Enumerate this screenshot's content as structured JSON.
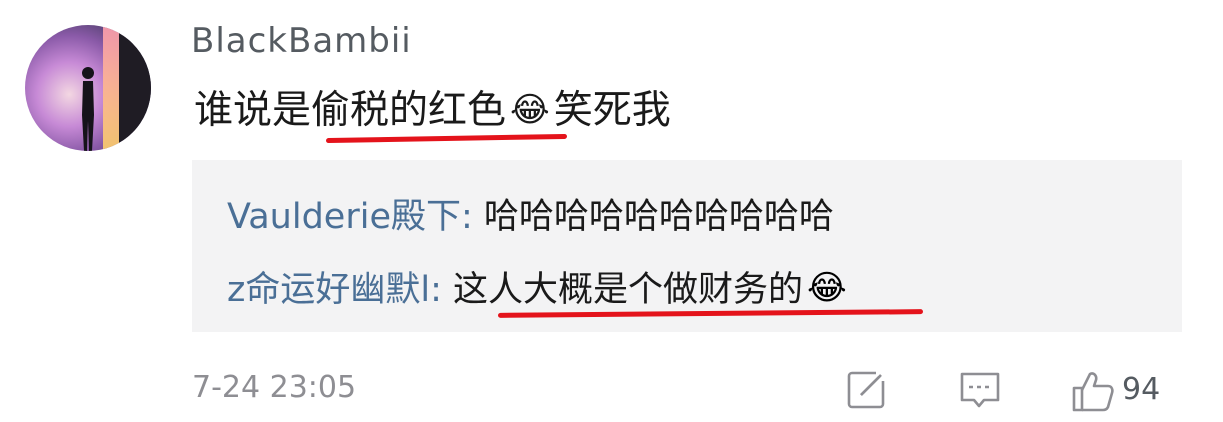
{
  "comment": {
    "username": "BlackBambii",
    "text_part1": "谁说是",
    "text_highlight": "偷税的红色",
    "emoji_1": "😂",
    "text_part2": "笑死我"
  },
  "replies": [
    {
      "user": "Vaulderie殿下",
      "separator": ": ",
      "message": "哈哈哈哈哈哈哈哈哈哈"
    },
    {
      "user": "z命运好幽默l",
      "separator": ": ",
      "message": "这人大概是个做财务的",
      "emoji": "😂"
    }
  ],
  "footer": {
    "timestamp": "7-24 23:05",
    "like_count": "94"
  },
  "icons": {
    "edit": "edit-icon",
    "comment": "comment-icon",
    "like": "thumbs-up-icon"
  },
  "colors": {
    "username": "#555b61",
    "reply_user": "#4a6f96",
    "reply_background": "#f3f3f4",
    "highlight_underline": "#e4131b",
    "timestamp": "#8e8e93"
  }
}
